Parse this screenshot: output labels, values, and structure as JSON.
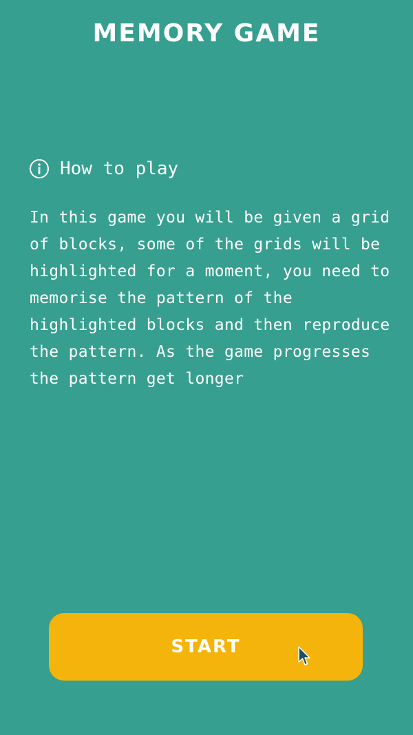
{
  "game": {
    "title": "Memory Game"
  },
  "instructions": {
    "heading": "How to play",
    "icon": "info-icon",
    "text": "In this game you will be given a grid of blocks, some of the grids will be highlighted for a moment, you need to memorise the pattern of the highlighted blocks and then reproduce the pattern. As the game progresses the pattern get longer"
  },
  "start_button": {
    "label": "Start"
  },
  "colors": {
    "background": "#369f8f",
    "button": "#f4b40b",
    "text": "#ffffff"
  }
}
